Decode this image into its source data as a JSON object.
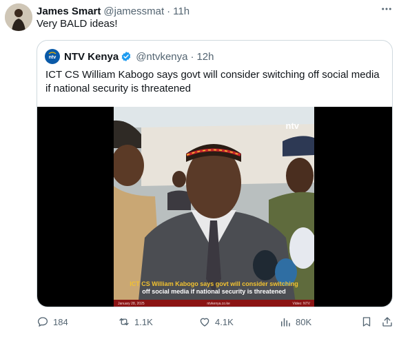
{
  "tweet": {
    "author_name": "James Smart",
    "author_handle": "@jamessmat",
    "separator": "·",
    "time": "11h",
    "text": "Very BALD ideas!",
    "more_icon": "more-horizontal-icon"
  },
  "quoted_tweet": {
    "author_name": "NTV Kenya",
    "author_handle": "@ntvkenya",
    "separator": "·",
    "time": "12h",
    "verified": true,
    "text": "ICT CS William Kabogo says govt will consider switching off social media if national security is threatened",
    "media": {
      "logo_text": "ntv",
      "caption_line1": "ICT CS William Kabogo says govt will consider switching",
      "caption_line2": "off social media if national security is threatened",
      "footer_date": "January 28, 2025",
      "footer_site": "ntvkenya.co.ke",
      "footer_credit": "Video: NTV"
    }
  },
  "actions": {
    "replies": "184",
    "reposts": "1.1K",
    "likes": "4.1K",
    "views": "80K"
  },
  "colors": {
    "text": "#0f1419",
    "muted": "#536471",
    "verified": "#1d9bf0",
    "border": "#cfd9de",
    "caption_yellow": "#f2c230",
    "caption_bar": "#8b1414"
  }
}
